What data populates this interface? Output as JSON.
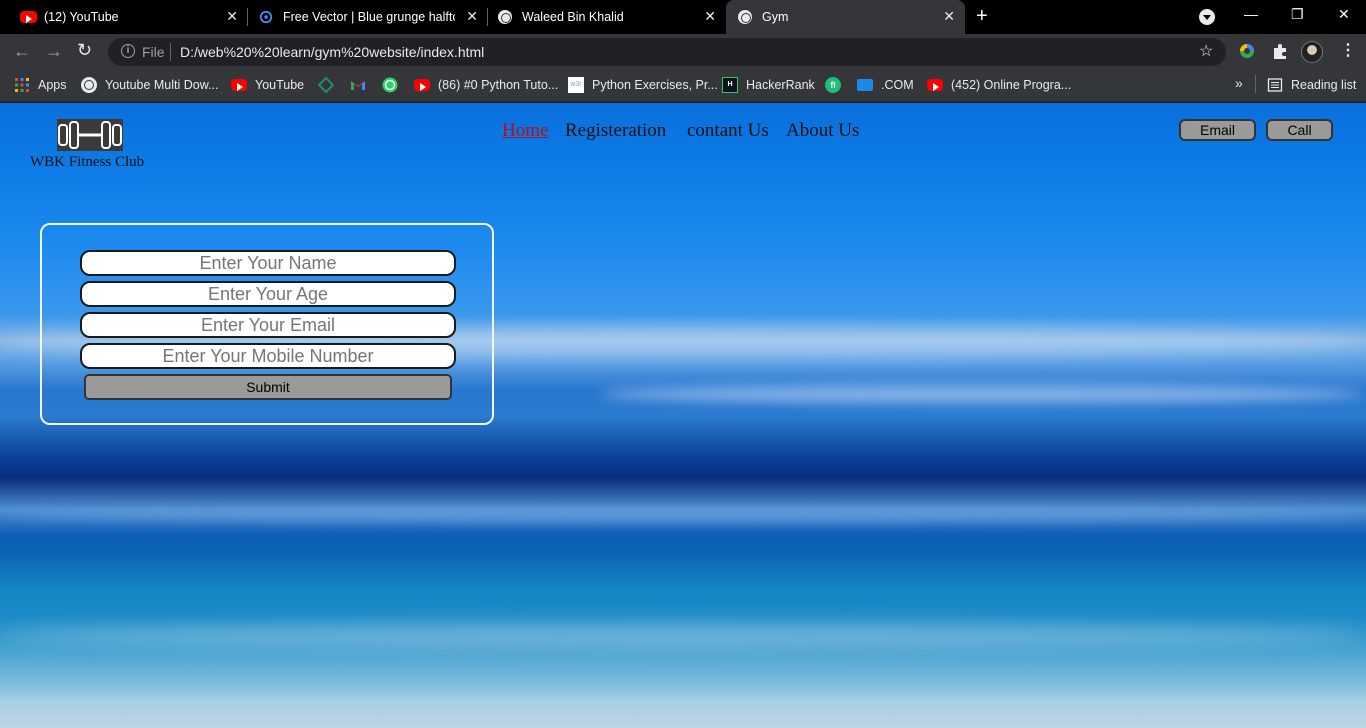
{
  "browser": {
    "tabs": [
      {
        "title": "(12) YouTube",
        "icon": "youtube-icon",
        "active": false
      },
      {
        "title": "Free Vector | Blue grunge halftone",
        "icon": "freepik-icon",
        "active": false
      },
      {
        "title": "Waleed Bin Khalid",
        "icon": "globe-icon",
        "active": false
      },
      {
        "title": "Gym",
        "icon": "globe-icon",
        "active": true
      }
    ],
    "new_tab": "+",
    "address": {
      "scheme_label": "File",
      "url": "D:/web%20%20learn/gym%20website/index.html"
    },
    "bookmarks": [
      {
        "label": "Apps",
        "icon": "apps-grid-icon"
      },
      {
        "label": "Youtube Multi Dow...",
        "icon": "globe-icon"
      },
      {
        "label": "YouTube",
        "icon": "youtube-icon"
      },
      {
        "label": "",
        "icon": "diamond-icon"
      },
      {
        "label": "",
        "icon": "gmail-icon"
      },
      {
        "label": "",
        "icon": "whatsapp-icon"
      },
      {
        "label": "(86) #0 Python Tuto...",
        "icon": "youtube-icon"
      },
      {
        "label": "Python Exercises, Pr...",
        "icon": "w3r-icon"
      },
      {
        "label": "HackerRank",
        "icon": "hackerrank-icon"
      },
      {
        "label": "",
        "icon": "fiverr-icon"
      },
      {
        "label": ".COM",
        "icon": "video-icon"
      },
      {
        "label": "(452) Online Progra...",
        "icon": "youtube-icon"
      }
    ],
    "more_bookmarks": "»",
    "reading_list": "Reading list"
  },
  "site": {
    "logo_text": "WBK Fitness Club",
    "nav": [
      "Home",
      "Registeration",
      "contant Us",
      "About Us"
    ],
    "contact_buttons": [
      "Email",
      "Call"
    ],
    "form": {
      "fields": [
        "Enter Your Name",
        "Enter Your Age",
        "Enter Your Email",
        "Enter Your Mobile Number"
      ],
      "submit": "Submit"
    }
  },
  "colors": {
    "nav_active": "#b0101a",
    "background_blue": "#0d7be6",
    "button_gray": "#9a9a9a"
  }
}
